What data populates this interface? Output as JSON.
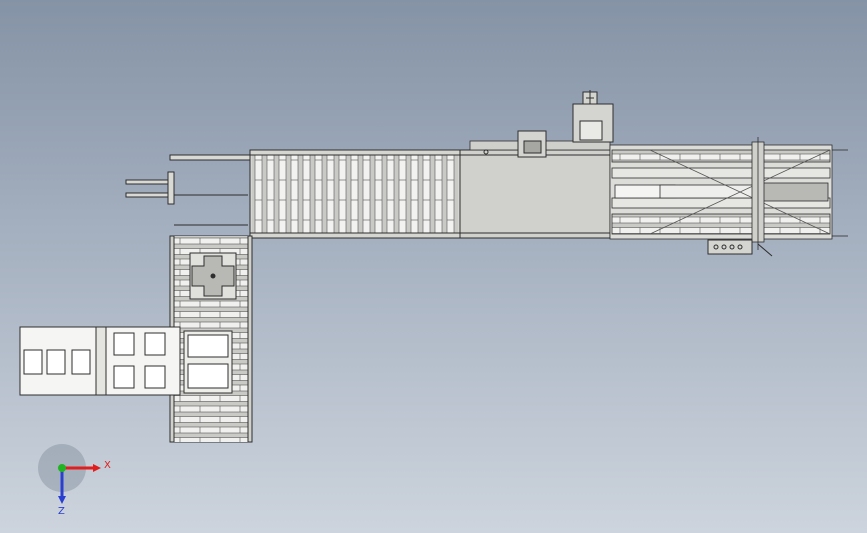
{
  "axis_triad": {
    "x_label": "X",
    "z_label": "Z",
    "x_color": "#e01e1e",
    "z_color": "#2a3fd0",
    "y_color": "#22b322"
  },
  "palette": {
    "background_top": "#8593a6",
    "background_bottom": "#cdd4dd",
    "frame_stroke": "#2e2e2e",
    "frame_fill": "#d7d7d3",
    "roller_fill": "#eeeeec",
    "plate_fill": "#cfcfcb"
  }
}
